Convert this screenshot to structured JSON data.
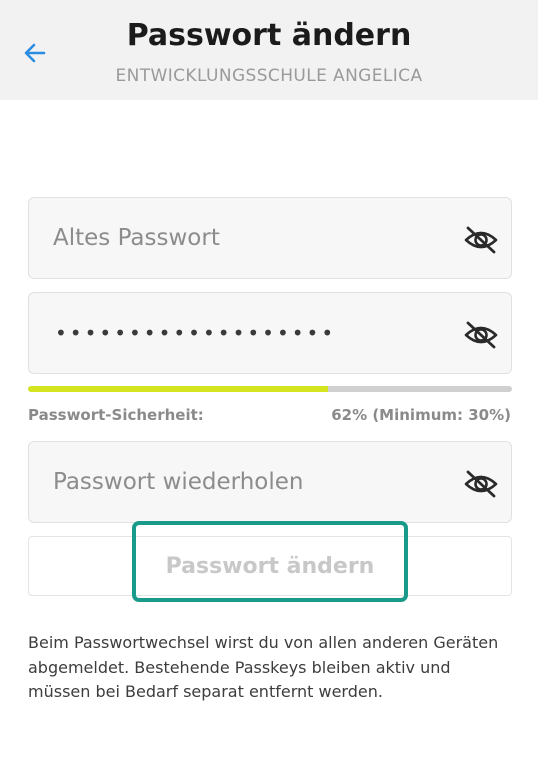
{
  "header": {
    "title": "Passwort ändern",
    "subtitle": "ENTWICKLUNGSSCHULE ANGELICA",
    "back_icon": "arrow-left-icon",
    "accent_color": "#2b8de0"
  },
  "form": {
    "old_password": {
      "placeholder": "Altes Passwort",
      "value": "",
      "toggle_icon": "eye-off-icon"
    },
    "new_password": {
      "masked_value": "•••••••••••••••••••",
      "toggle_icon": "eye-off-icon"
    },
    "strength": {
      "label": "Passwort-Sicherheit:",
      "value_text": "62% (Minimum: 30%)",
      "percent": 62,
      "minimum_percent": 30,
      "fill_color": "#d4e41e"
    },
    "repeat_password": {
      "placeholder": "Passwort wiederholen",
      "value": "",
      "toggle_icon": "eye-off-icon"
    },
    "submit_label": "Passwort ändern"
  },
  "info_text": "Beim Passwortwechsel wirst du von allen anderen Geräten abgemeldet. Bestehende Passkeys bleiben aktiv und müssen bei Bedarf separat entfernt werden."
}
